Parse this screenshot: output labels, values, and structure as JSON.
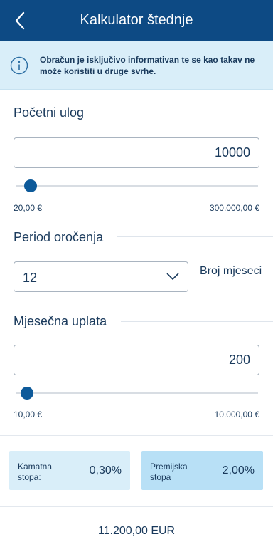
{
  "header": {
    "title": "Kalkulator štednje",
    "back_icon": "chevron-left-icon",
    "background": "#0d4a84"
  },
  "info": {
    "icon": "info-circle-icon",
    "text": "Obračun je isključivo informativan te se kao takav ne može koristiti u druge svrhe.",
    "background": "#d9eef9"
  },
  "initial_deposit": {
    "label": "Početni ulog",
    "value": "10000",
    "min_label": "20,00 €",
    "max_label": "300.000,00 €",
    "slider_fraction": 0.033
  },
  "term": {
    "label": "Period oročenja",
    "selected": "12",
    "note": "Broj mjeseci",
    "icon": "chevron-down-icon"
  },
  "monthly_payment": {
    "label": "Mjesečna uplata",
    "value": "200",
    "min_label": "10,00 €",
    "max_label": "10.000,00 €",
    "slider_fraction": 0.019
  },
  "rates": {
    "interest": {
      "label": "Kamatna stopa:",
      "value": "0,30%",
      "background": "#d9eef9"
    },
    "premium": {
      "label": "Premijska stopa",
      "value": "2,00%",
      "background": "#b8e0f6"
    }
  },
  "total": "11.200,00 EUR"
}
